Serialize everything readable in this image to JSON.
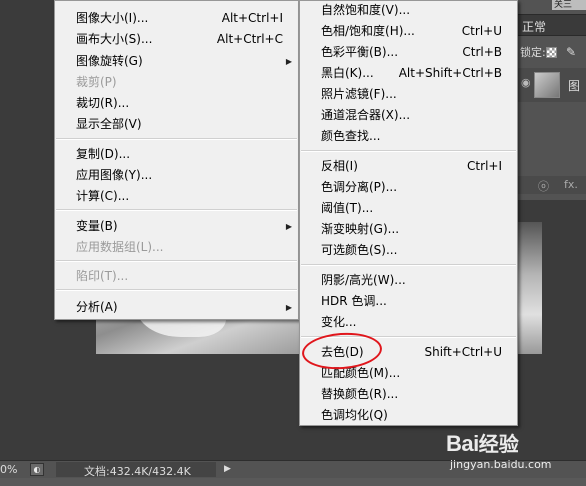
{
  "background": {
    "blend_mode": "正常",
    "top_chip": "关三",
    "lock_label": "锁定:",
    "layer_name": "图",
    "layer_footer": [
      "ⓞ",
      "fx."
    ],
    "status": {
      "zoom": "0%",
      "doc_info": "文档:432.4K/432.4K"
    }
  },
  "image_menu": {
    "items": [
      {
        "label": "图像大小(I)...",
        "shortcut": "Alt+Ctrl+I",
        "disabled": false
      },
      {
        "label": "画布大小(S)...",
        "shortcut": "Alt+Ctrl+C",
        "disabled": false
      },
      {
        "label": "图像旋转(G)",
        "submenu": true,
        "disabled": false
      },
      {
        "label": "裁剪(P)",
        "disabled": true
      },
      {
        "label": "裁切(R)...",
        "disabled": false
      },
      {
        "label": "显示全部(V)",
        "disabled": false
      },
      {
        "label": "复制(D)...",
        "disabled": false
      },
      {
        "label": "应用图像(Y)...",
        "disabled": false
      },
      {
        "label": "计算(C)...",
        "disabled": false
      },
      {
        "label": "变量(B)",
        "submenu": true,
        "disabled": false
      },
      {
        "label": "应用数据组(L)...",
        "disabled": true
      },
      {
        "label": "陷印(T)...",
        "disabled": true
      },
      {
        "label": "分析(A)",
        "submenu": true,
        "disabled": false
      }
    ]
  },
  "adjust_menu": {
    "items": [
      {
        "label": "自然饱和度(V)...",
        "shortcut": ""
      },
      {
        "label": "色相/饱和度(H)...",
        "shortcut": "Ctrl+U"
      },
      {
        "label": "色彩平衡(B)...",
        "shortcut": "Ctrl+B"
      },
      {
        "label": "黑白(K)...",
        "shortcut": "Alt+Shift+Ctrl+B"
      },
      {
        "label": "照片滤镜(F)...",
        "shortcut": ""
      },
      {
        "label": "通道混合器(X)...",
        "shortcut": ""
      },
      {
        "label": "颜色查找...",
        "shortcut": ""
      },
      {
        "label": "反相(I)",
        "shortcut": "Ctrl+I"
      },
      {
        "label": "色调分离(P)...",
        "shortcut": ""
      },
      {
        "label": "阈值(T)...",
        "shortcut": ""
      },
      {
        "label": "渐变映射(G)...",
        "shortcut": ""
      },
      {
        "label": "可选颜色(S)...",
        "shortcut": ""
      },
      {
        "label": "阴影/高光(W)...",
        "shortcut": ""
      },
      {
        "label": "HDR 色调...",
        "shortcut": ""
      },
      {
        "label": "变化...",
        "shortcut": ""
      },
      {
        "label": "去色(D)",
        "shortcut": "Shift+Ctrl+U",
        "highlighted": true
      },
      {
        "label": "匹配颜色(M)...",
        "shortcut": ""
      },
      {
        "label": "替换颜色(R)...",
        "shortcut": ""
      },
      {
        "label": "色调均化(Q)",
        "shortcut": ""
      }
    ]
  },
  "watermark": {
    "logo": "Bai",
    "logo_suffix": "经验",
    "url": "jingyan.baidu.com"
  },
  "colors": {
    "highlight_circle": "#e0161c",
    "menu_bg": "#f0f0f0",
    "app_bg": "#3d3d3d"
  }
}
